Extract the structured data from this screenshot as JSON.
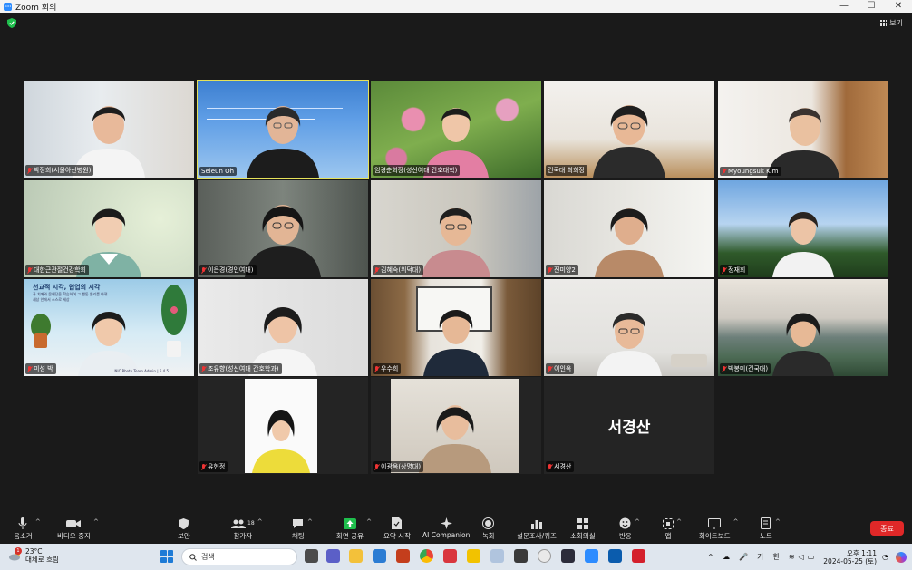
{
  "window": {
    "title": "Zoom 회의",
    "logo_text": "zm",
    "controls": [
      "—",
      "☐",
      "✕"
    ]
  },
  "header": {
    "view_label": "보기"
  },
  "participants": [
    {
      "name": "박정희(서울아산병원)",
      "muted": true
    },
    {
      "name": "Seieun Oh",
      "muted": false,
      "active": true
    },
    {
      "name": "임경춘회장(성신여대 간호대학)",
      "muted": false
    },
    {
      "name": "건국대 최희정",
      "muted": false
    },
    {
      "name": "Myoungsuk Kim",
      "muted": true
    },
    {
      "name": "대한근관절건강학회",
      "muted": true
    },
    {
      "name": "이은경(경인여대)",
      "muted": true
    },
    {
      "name": "김혜숙(위덕대)",
      "muted": true
    },
    {
      "name": "전미양2",
      "muted": true
    },
    {
      "name": "정재희",
      "muted": true
    },
    {
      "name": "미성 박",
      "muted": true
    },
    {
      "name": "조유향(성신여대 간호학과)",
      "muted": true
    },
    {
      "name": "우수희",
      "muted": true
    },
    {
      "name": "이인옥",
      "muted": true
    },
    {
      "name": "박봉미(건국대)",
      "muted": true
    },
    {
      "name": "유현정",
      "muted": true
    },
    {
      "name": "이광옥(상명대)",
      "muted": true
    },
    {
      "name": "서경산",
      "muted": true,
      "video_off": true,
      "display_text": "서경산"
    }
  ],
  "slide_text": {
    "line1": "선교적 시각, 협업의 시각",
    "line2": "규 치매와 문해당을 학습하여 그 행동 원리를 바꿔",
    "line3": "세상 안에서 스스로 세상",
    "credit": "NIC Photo Team Admin | 5.4.5"
  },
  "toolbar": {
    "mute": "음소거",
    "video": "비디오 중지",
    "security": "보안",
    "participants": "참가자",
    "participants_count": "18",
    "chat": "채팅",
    "share": "화면 공유",
    "summary": "요약 시작",
    "ai": "AI Companion",
    "record": "녹화",
    "polls": "설문조사/퀴즈",
    "breakout": "소회의실",
    "reactions": "반응",
    "apps": "앱",
    "whiteboard": "화이트보드",
    "notes": "노트",
    "end": "종료"
  },
  "taskbar": {
    "temperature": "23°C",
    "weather_desc": "대체로 흐림",
    "weather_badge": "1",
    "search_placeholder": "검색",
    "ime_1": "가",
    "ime_2": "한",
    "time": "오후 1:11",
    "date": "2024-05-25 (토)"
  },
  "colors": {
    "active_speaker": "#e6e25a",
    "end_button": "#e02828",
    "share_green": "#1fbf4d",
    "accent_blue": "#2d8cff"
  }
}
